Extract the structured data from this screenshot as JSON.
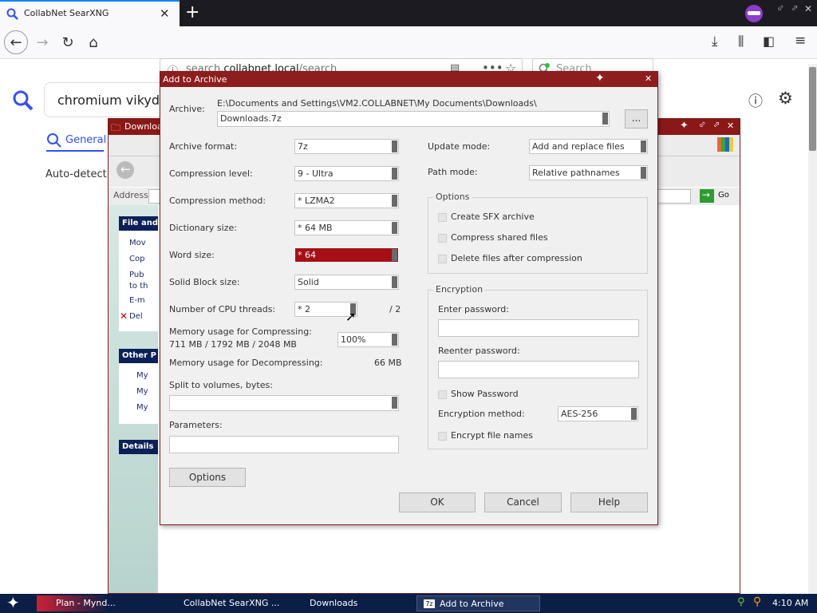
{
  "browser": {
    "tab_title": "CollabNet SearXNG",
    "url_prefix": "search.",
    "url_domain": "collabnet.local",
    "url_path": "/search",
    "search_placeholder": "Search"
  },
  "searx": {
    "query": "chromium vikyd",
    "tab_general": "General",
    "autodetect_text": "Auto-detect (e"
  },
  "explorer": {
    "title": "Downloads",
    "address_label": "Address",
    "go_label": "Go",
    "tasks_group": "File and",
    "tasks": [
      "Mov",
      "Cop",
      "Pub",
      "to th",
      "E-m",
      "Del"
    ],
    "other_group": "Other P",
    "other_items": [
      "My",
      "My",
      "My"
    ],
    "details_group": "Details"
  },
  "dialog": {
    "title": "Add to Archive",
    "archive_label": "Archive:",
    "archive_path": "E:\\Documents and Settings\\VM2.COLLABNET\\My Documents\\Downloads\\",
    "archive_name": "Downloads.7z",
    "browse_label": "...",
    "archive_format_label": "Archive format:",
    "archive_format": "7z",
    "compression_level_label": "Compression level:",
    "compression_level": "9 - Ultra",
    "compression_method_label": "Compression method:",
    "compression_method": "* LZMA2",
    "dictionary_size_label": "Dictionary size:",
    "dictionary_size": "* 64 MB",
    "word_size_label": "Word size:",
    "word_size": "* 64",
    "solid_block_label": "Solid Block size:",
    "solid_block": "Solid",
    "cpu_threads_label": "Number of CPU threads:",
    "cpu_threads": "* 2",
    "cpu_threads_max": "/ 2",
    "mem_compress_label": "Memory usage for Compressing:",
    "mem_compress_values": "711 MB / 1792 MB / 2048 MB",
    "mem_percent": "100%",
    "mem_decompress_label": "Memory usage for Decompressing:",
    "mem_decompress_value": "66 MB",
    "split_label": "Split to volumes, bytes:",
    "parameters_label": "Parameters:",
    "options_button": "Options",
    "update_mode_label": "Update mode:",
    "update_mode": "Add and replace files",
    "path_mode_label": "Path mode:",
    "path_mode": "Relative pathnames",
    "options_group": "Options",
    "opt_sfx": "Create SFX archive",
    "opt_shared": "Compress shared files",
    "opt_delete": "Delete files after compression",
    "encryption_group": "Encryption",
    "enter_password_label": "Enter password:",
    "reenter_password_label": "Reenter password:",
    "show_password": "Show Password",
    "enc_method_label": "Encryption method:",
    "enc_method": "AES-256",
    "encrypt_names": "Encrypt file names",
    "ok": "OK",
    "cancel": "Cancel",
    "help": "Help"
  },
  "taskbar": {
    "items": [
      "Plan - Mynd...",
      "CollabNet SearXNG ...",
      "Downloads",
      "Add to Archive"
    ],
    "clock": "4:10 AM"
  },
  "colors": {
    "accent": "#0a84ff",
    "title_red": "#8e1d1d",
    "highlight_red": "#a60f16",
    "taskbar": "#0b1e46"
  }
}
